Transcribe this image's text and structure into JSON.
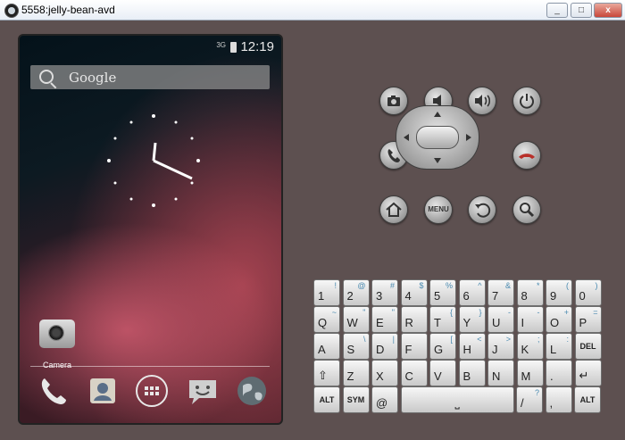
{
  "window": {
    "title": "5558:jelly-bean-avd",
    "minimize": "_",
    "restore": "□",
    "close": "x"
  },
  "phone": {
    "status": {
      "network": "3G",
      "time": "12:19"
    },
    "search": {
      "label": "Google"
    },
    "app": {
      "label": "Camera"
    },
    "dock": [
      "phone",
      "contacts",
      "apps",
      "messaging",
      "browser"
    ]
  },
  "controls": {
    "menu_label": "MENU"
  },
  "keyboard": {
    "row1": [
      [
        "1",
        "!"
      ],
      [
        "2",
        "@"
      ],
      [
        "3",
        "#"
      ],
      [
        "4",
        "$"
      ],
      [
        "5",
        "%"
      ],
      [
        "6",
        "^"
      ],
      [
        "7",
        "&"
      ],
      [
        "8",
        "*"
      ],
      [
        "9",
        "("
      ],
      [
        "0",
        ")"
      ]
    ],
    "row2": [
      [
        "Q",
        "~"
      ],
      [
        "W",
        "\""
      ],
      [
        "E",
        "\""
      ],
      [
        "R",
        ""
      ],
      [
        "T",
        "{"
      ],
      [
        "Y",
        "}"
      ],
      [
        "U",
        "-"
      ],
      [
        "I",
        "-"
      ],
      [
        "O",
        "+"
      ],
      [
        "P",
        "="
      ]
    ],
    "row3": [
      [
        "A",
        ""
      ],
      [
        "S",
        "\\"
      ],
      [
        "D",
        "|"
      ],
      [
        "F",
        ""
      ],
      [
        "G",
        "["
      ],
      [
        "H",
        "<"
      ],
      [
        "J",
        ">"
      ],
      [
        "K",
        ";"
      ],
      [
        "L",
        ":"
      ],
      [
        "DEL",
        ""
      ]
    ],
    "row4": [
      [
        "⇧",
        ""
      ],
      [
        "Z",
        ""
      ],
      [
        "X",
        ""
      ],
      [
        "C",
        ""
      ],
      [
        "V",
        ""
      ],
      [
        "B",
        ""
      ],
      [
        "N",
        ""
      ],
      [
        "M",
        ""
      ],
      [
        ".",
        ""
      ],
      [
        "↵",
        ""
      ]
    ],
    "row5": [
      [
        "ALT",
        ""
      ],
      [
        "SYM",
        ""
      ],
      [
        "@",
        ""
      ],
      [
        "␣",
        ""
      ],
      [
        "/",
        "?"
      ],
      [
        ",",
        ""
      ],
      [
        "ALT",
        ""
      ]
    ]
  }
}
